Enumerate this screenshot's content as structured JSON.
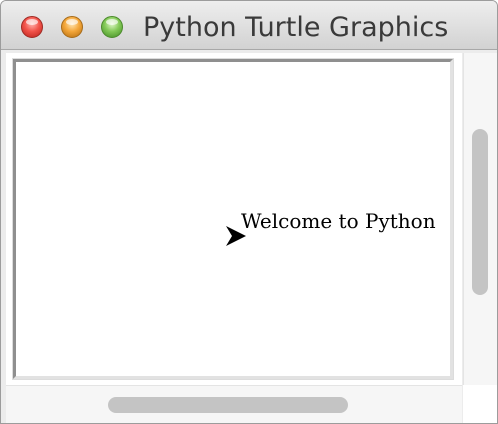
{
  "window": {
    "title": "Python Turtle Graphics"
  },
  "canvas": {
    "text": "Welcome to Python",
    "turtle_icon": "arrow-turtle-icon",
    "turtle_color": "#000000",
    "background": "#ffffff"
  },
  "colors": {
    "close": "#f2534a",
    "minimize": "#f4a73a",
    "zoom": "#83c957"
  }
}
